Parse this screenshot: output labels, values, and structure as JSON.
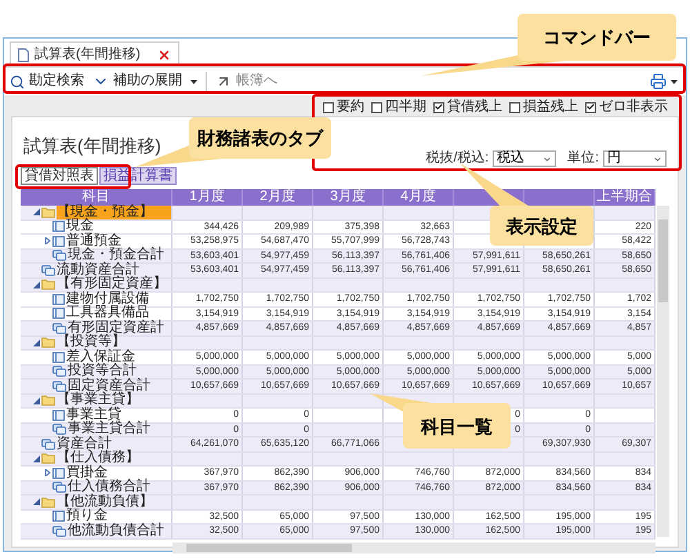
{
  "window_tab": {
    "title": "試算表(年間推移)"
  },
  "command_bar": {
    "items": [
      {
        "kind": "search",
        "label": "勘定検索",
        "dropdown": false,
        "disabled": false
      },
      {
        "kind": "expand",
        "label": "補助の展開",
        "dropdown": true,
        "disabled": false
      },
      {
        "kind": "jump",
        "label": "帳簿へ",
        "dropdown": false,
        "disabled": true
      }
    ]
  },
  "display_settings": {
    "options": [
      {
        "label": "要約",
        "checked": false
      },
      {
        "label": "四半期",
        "checked": false
      },
      {
        "label": "貸借残上",
        "checked": true
      },
      {
        "label": "損益残上",
        "checked": false
      },
      {
        "label": "ゼロ非表示",
        "checked": true
      }
    ],
    "tax": {
      "label": "税抜/税込:",
      "value": "税込"
    },
    "unit": {
      "label": "単位:",
      "value": "円"
    }
  },
  "page_title": "試算表(年間推移)",
  "statement_tabs": [
    {
      "label": "貸借対照表",
      "selected": true
    },
    {
      "label": "損益計算書",
      "selected": false
    }
  ],
  "table": {
    "columns": {
      "0": "科目",
      "1": "1月度",
      "2": "2月度",
      "3": "3月度",
      "4": "4月度",
      "7": "上半期合"
    },
    "rows": [
      {
        "kind": "group",
        "label": "【現金・預金】",
        "expanded": true,
        "selected": true,
        "children": [
          {
            "kind": "account",
            "label": "現金",
            "selected": false,
            "values": {
              "1": "344,426",
              "2": "209,989",
              "3": "375,398",
              "4": "32,663",
              "7": "220"
            }
          },
          {
            "kind": "account",
            "label": "普通預金",
            "expanded": false,
            "selected": false,
            "values": {
              "1": "53,258,975",
              "2": "54,687,470",
              "3": "55,707,999",
              "4": "56,728,743",
              "7": "58,422"
            }
          },
          {
            "kind": "total",
            "label": "現金・預金合計",
            "selected": false,
            "values": {
              "1": "53,603,401",
              "2": "54,977,459",
              "3": "56,113,397",
              "4": "56,761,406",
              "5": "57,991,611",
              "6": "58,650,261",
              "7": "58,650"
            }
          }
        ]
      },
      {
        "kind": "total",
        "label": "流動資産合計",
        "selected": false,
        "values": {
          "1": "53,603,401",
          "2": "54,977,459",
          "3": "56,113,397",
          "4": "56,761,406",
          "5": "57,991,611",
          "6": "58,650,261",
          "7": "58,650"
        }
      },
      {
        "kind": "group",
        "label": "【有形固定資産】",
        "expanded": true,
        "selected": false,
        "children": [
          {
            "kind": "account",
            "label": "建物付属設備",
            "selected": false,
            "values": {
              "1": "1,702,750",
              "2": "1,702,750",
              "3": "1,702,750",
              "4": "1,702,750",
              "5": "1,702,750",
              "6": "1,702,750",
              "7": "1,702"
            }
          },
          {
            "kind": "account",
            "label": "工具器具備品",
            "selected": false,
            "values": {
              "1": "3,154,919",
              "2": "3,154,919",
              "3": "3,154,919",
              "4": "3,154,919",
              "5": "3,154,919",
              "6": "3,154,919",
              "7": "3,154"
            }
          },
          {
            "kind": "total",
            "label": "有形固定資産計",
            "selected": false,
            "values": {
              "1": "4,857,669",
              "2": "4,857,669",
              "3": "4,857,669",
              "4": "4,857,669",
              "5": "4,857,669",
              "6": "4,857,669",
              "7": "4,857"
            }
          }
        ]
      },
      {
        "kind": "group",
        "label": "【投資等】",
        "expanded": true,
        "selected": false,
        "children": [
          {
            "kind": "account",
            "label": "差入保証金",
            "selected": false,
            "values": {
              "1": "5,000,000",
              "2": "5,000,000",
              "3": "5,000,000",
              "4": "5,000,000",
              "5": "5,000,000",
              "6": "5,000,000",
              "7": "5,000"
            }
          },
          {
            "kind": "total",
            "label": "投資等合計",
            "selected": false,
            "values": {
              "1": "5,000,000",
              "2": "5,000,000",
              "3": "5,000,000",
              "4": "5,000,000",
              "5": "5,000,000",
              "6": "5,000,000",
              "7": "5,000"
            }
          },
          {
            "kind": "total",
            "label": "固定資産合計",
            "selected": false,
            "values": {
              "1": "10,657,669",
              "2": "10,657,669",
              "3": "10,657,669",
              "4": "10,657,669",
              "5": "10,657,669",
              "6": "10,657,669",
              "7": "10,657"
            }
          }
        ]
      },
      {
        "kind": "group",
        "label": "【事業主貸】",
        "expanded": true,
        "selected": false,
        "children": [
          {
            "kind": "account",
            "label": "事業主貸",
            "selected": false,
            "values": {
              "1": "0",
              "2": "0",
              "5": "0",
              "6": "0"
            }
          },
          {
            "kind": "total",
            "label": "事業主貸合計",
            "selected": false,
            "values": {
              "1": "0",
              "2": "0",
              "5": "0",
              "6": "0"
            }
          }
        ]
      },
      {
        "kind": "total",
        "label": "資産合計",
        "selected": false,
        "values": {
          "1": "64,261,070",
          "2": "65,635,120",
          "3": "66,771,066",
          "6": "69,307,930",
          "7": "69,307"
        }
      },
      {
        "kind": "group",
        "label": "【仕入債務】",
        "expanded": true,
        "selected": false,
        "children": [
          {
            "kind": "account",
            "label": "買掛金",
            "expanded": false,
            "selected": false,
            "values": {
              "1": "367,970",
              "2": "862,390",
              "3": "906,000",
              "4": "746,760",
              "5": "872,000",
              "6": "834,560",
              "7": "834"
            }
          },
          {
            "kind": "total",
            "label": "仕入債務合計",
            "selected": false,
            "values": {
              "1": "367,970",
              "2": "862,390",
              "3": "906,000",
              "4": "746,760",
              "5": "872,000",
              "6": "834,560",
              "7": "834"
            }
          }
        ]
      },
      {
        "kind": "group",
        "label": "【他流動負債】",
        "expanded": true,
        "selected": false,
        "children": [
          {
            "kind": "account",
            "label": "預り金",
            "selected": false,
            "values": {
              "1": "32,500",
              "2": "65,000",
              "3": "97,500",
              "4": "130,000",
              "5": "162,500",
              "6": "195,000",
              "7": "195"
            }
          },
          {
            "kind": "total",
            "label": "他流動負債合計",
            "selected": false,
            "values": {
              "1": "32,500",
              "2": "65,000",
              "3": "97,500",
              "4": "130,000",
              "5": "162,500",
              "6": "195,000",
              "7": "195"
            }
          }
        ]
      }
    ]
  },
  "callouts": [
    {
      "kind": "command",
      "text": "コマンドバー"
    },
    {
      "kind": "tabs",
      "text": "財務諸表のタブ"
    },
    {
      "kind": "settings",
      "text": "表示設定"
    },
    {
      "kind": "list",
      "text": "科目一覧"
    }
  ]
}
